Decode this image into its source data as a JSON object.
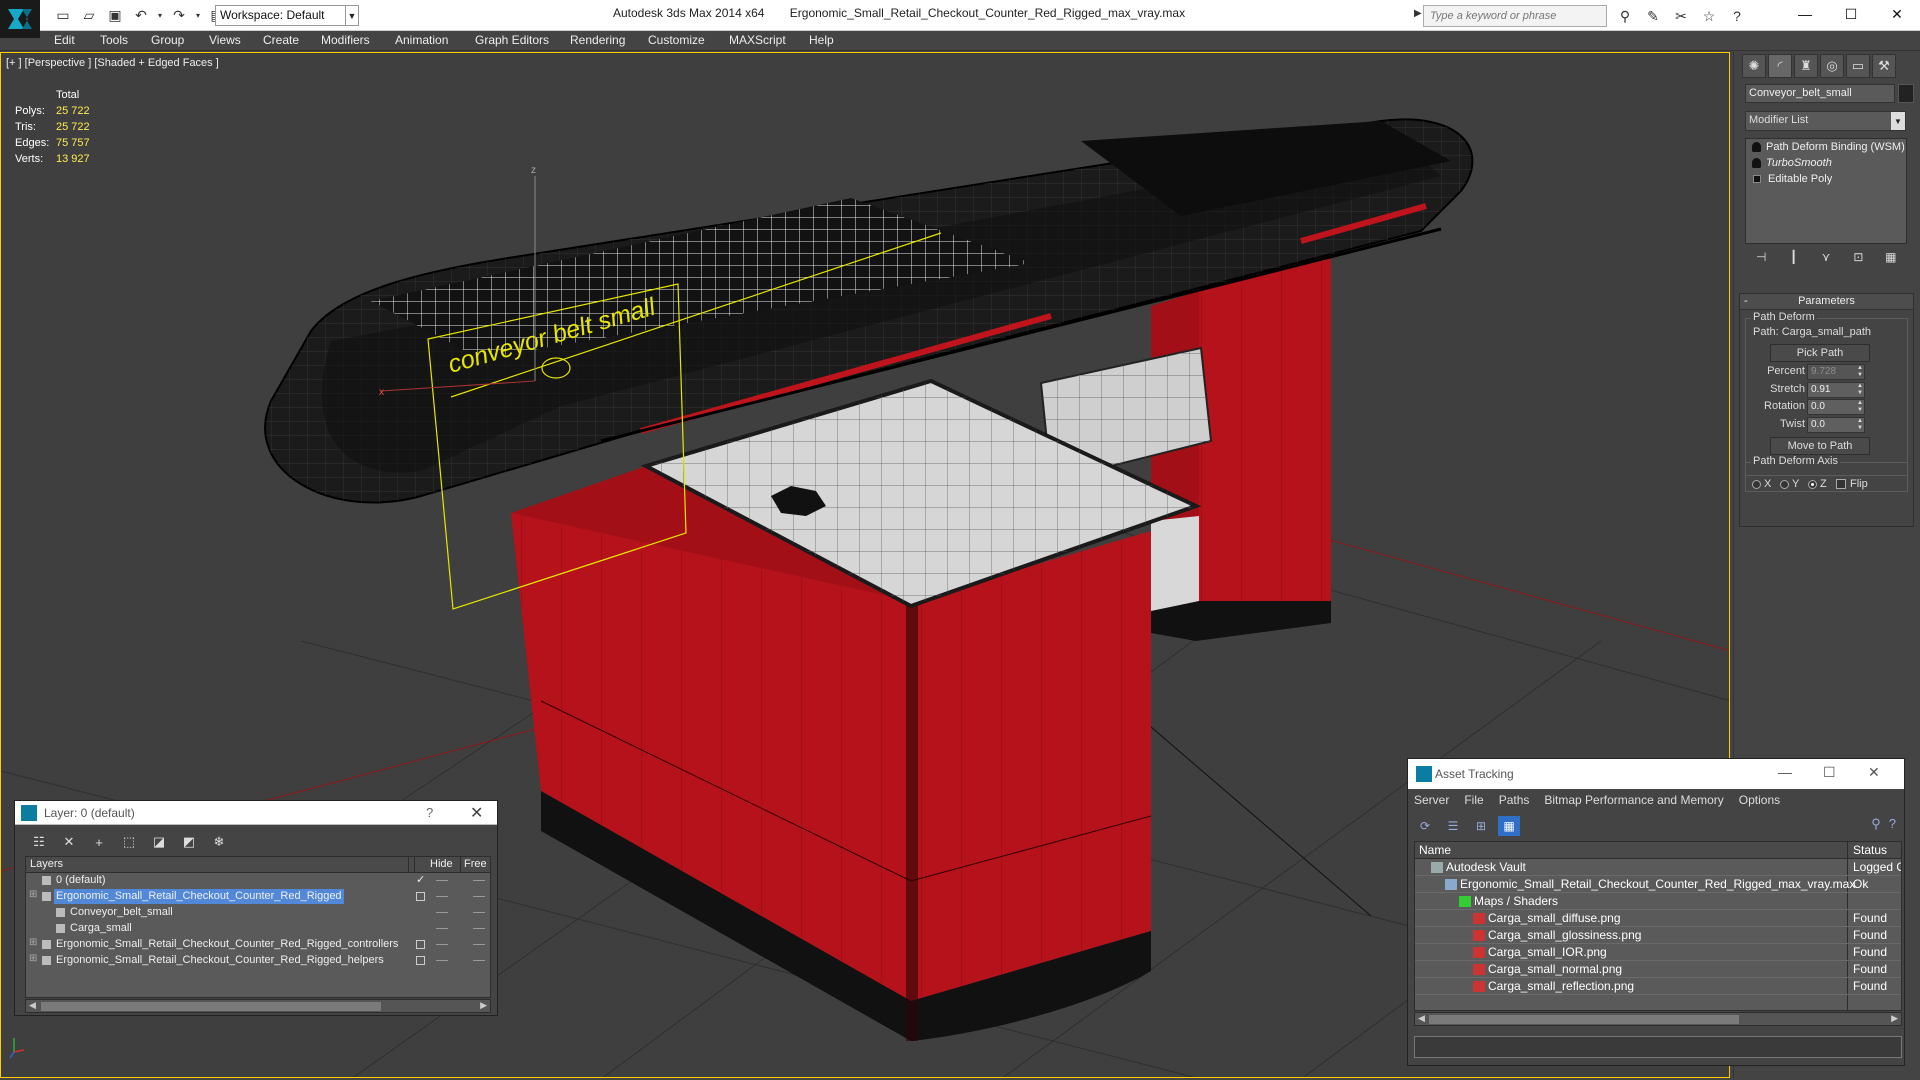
{
  "app": {
    "title": "Autodesk 3ds Max  2014 x64",
    "file": "Ergonomic_Small_Retail_Checkout_Counter_Red_Rigged_max_vray.max",
    "workspace": "Workspace: Default",
    "search_placeholder": "Type a keyword or phrase"
  },
  "menu": [
    "Edit",
    "Tools",
    "Group",
    "Views",
    "Create",
    "Modifiers",
    "Animation",
    "Graph Editors",
    "Rendering",
    "Customize",
    "MAXScript",
    "Help"
  ],
  "viewport": {
    "label": "[+ ] [Perspective ] [Shaded + Edged Faces ]",
    "stats": {
      "header": "Total",
      "rows": [
        {
          "k": "Polys:",
          "v": "25 722"
        },
        {
          "k": "Tris:",
          "v": "25 722"
        },
        {
          "k": "Edges:",
          "v": "75 757"
        },
        {
          "k": "Verts:",
          "v": "13 927"
        }
      ]
    },
    "shape_text": "conveyor belt small",
    "gizmo": {
      "z": "z",
      "x": "x"
    }
  },
  "command_panel": {
    "object_name": "Conveyor_belt_small",
    "modifier_list": "Modifier List",
    "stack": [
      "Path Deform Binding (WSM)",
      "TurboSmooth",
      "Editable Poly"
    ],
    "rollout_title": "Parameters",
    "path_deform_group": "Path Deform",
    "path": "Path: Carga_small_path",
    "pick_path": "Pick Path",
    "params": [
      {
        "label": "Percent",
        "value": "9.728"
      },
      {
        "label": "Stretch",
        "value": "0.91"
      },
      {
        "label": "Rotation",
        "value": "0.0"
      },
      {
        "label": "Twist",
        "value": "0.0"
      }
    ],
    "move_to_path": "Move to Path",
    "axis_group": "Path Deform Axis",
    "axis": {
      "x": "X",
      "y": "Y",
      "z": "Z",
      "flip": "Flip",
      "selected": "Z"
    }
  },
  "layer_dialog": {
    "title": "Layer: 0 (default)",
    "help": "?",
    "columns": {
      "layers": "Layers",
      "hide": "Hide",
      "freeze": "Free"
    },
    "rows": [
      {
        "name": "0 (default)",
        "indent": 0,
        "selected": false,
        "box": false,
        "check": true
      },
      {
        "name": "Ergonomic_Small_Retail_Checkout_Counter_Red_Rigged",
        "indent": 0,
        "selected": true,
        "box": true,
        "check": false
      },
      {
        "name": "Conveyor_belt_small",
        "indent": 1,
        "selected": false,
        "box": false,
        "check": false
      },
      {
        "name": "Carga_small",
        "indent": 1,
        "selected": false,
        "box": false,
        "check": false
      },
      {
        "name": "Ergonomic_Small_Retail_Checkout_Counter_Red_Rigged_controllers",
        "indent": 0,
        "selected": false,
        "box": true,
        "check": false
      },
      {
        "name": "Ergonomic_Small_Retail_Checkout_Counter_Red_Rigged_helpers",
        "indent": 0,
        "selected": false,
        "box": true,
        "check": false
      }
    ]
  },
  "asset_tracking": {
    "title": "Asset Tracking",
    "menu": [
      "Server",
      "File",
      "Paths",
      "Bitmap Performance and Memory",
      "Options"
    ],
    "columns": {
      "name": "Name",
      "status": "Status"
    },
    "rows": [
      {
        "name": "Autodesk Vault",
        "status": "Logged O",
        "indent": 0,
        "icon": "vault"
      },
      {
        "name": "Ergonomic_Small_Retail_Checkout_Counter_Red_Rigged_max_vray.max",
        "status": "Ok",
        "indent": 1,
        "icon": "max"
      },
      {
        "name": "Maps / Shaders",
        "status": "",
        "indent": 2,
        "icon": "maps"
      },
      {
        "name": "Carga_small_diffuse.png",
        "status": "Found",
        "indent": 3,
        "icon": "png"
      },
      {
        "name": "Carga_small_glossiness.png",
        "status": "Found",
        "indent": 3,
        "icon": "png"
      },
      {
        "name": "Carga_small_IOR.png",
        "status": "Found",
        "indent": 3,
        "icon": "png"
      },
      {
        "name": "Carga_small_normal.png",
        "status": "Found",
        "indent": 3,
        "icon": "png"
      },
      {
        "name": "Carga_small_reflection.png",
        "status": "Found",
        "indent": 3,
        "icon": "png"
      }
    ]
  },
  "colors": {
    "counter_red": "#b5121b",
    "stat_yellow": "#ffeb57",
    "selection_blue": "#5288d8",
    "viewport_bg": "#3f3f3f"
  }
}
